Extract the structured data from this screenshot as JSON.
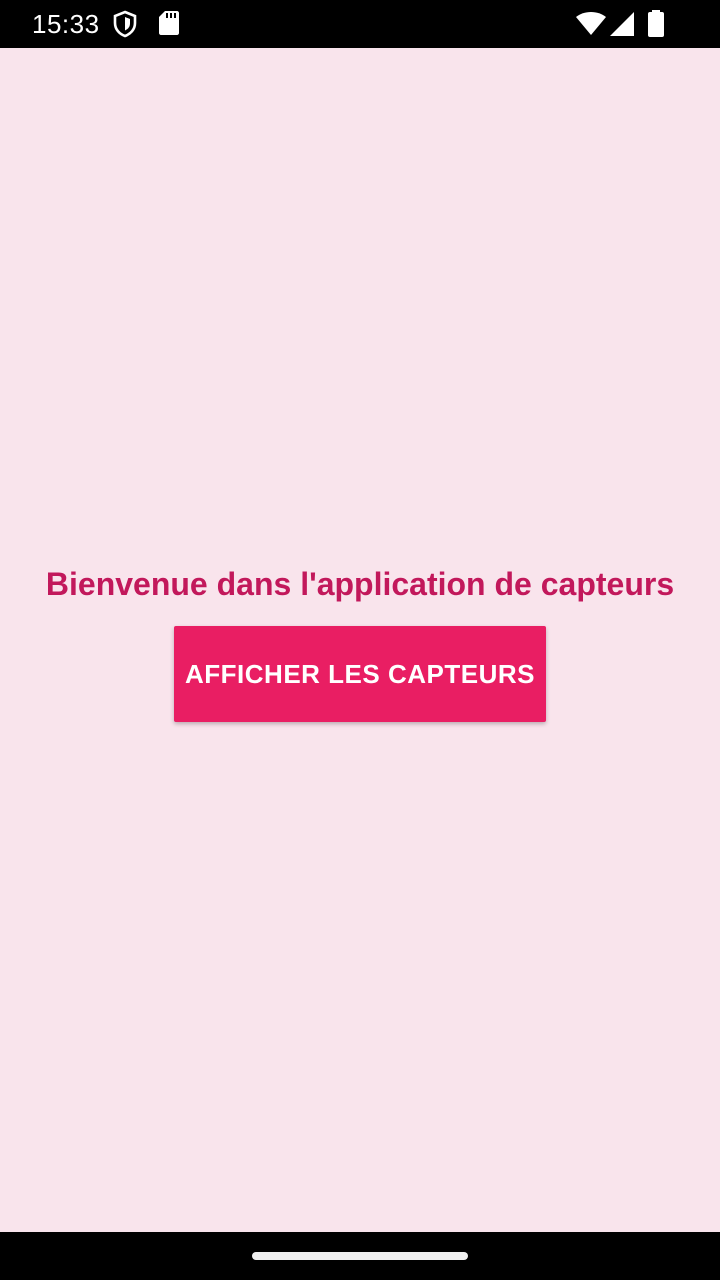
{
  "status_bar": {
    "time": "15:33",
    "icons": [
      "shield-icon",
      "sd-card-icon",
      "wifi-icon",
      "signal-icon",
      "battery-icon"
    ]
  },
  "main": {
    "title": "Bienvenue dans l'application de capteurs",
    "button_label": "AFFICHER LES CAPTEURS"
  },
  "colors": {
    "background": "#f9e4ec",
    "title": "#c2185b",
    "button": "#e91e63",
    "button_text": "#ffffff",
    "system_bars": "#000000"
  }
}
